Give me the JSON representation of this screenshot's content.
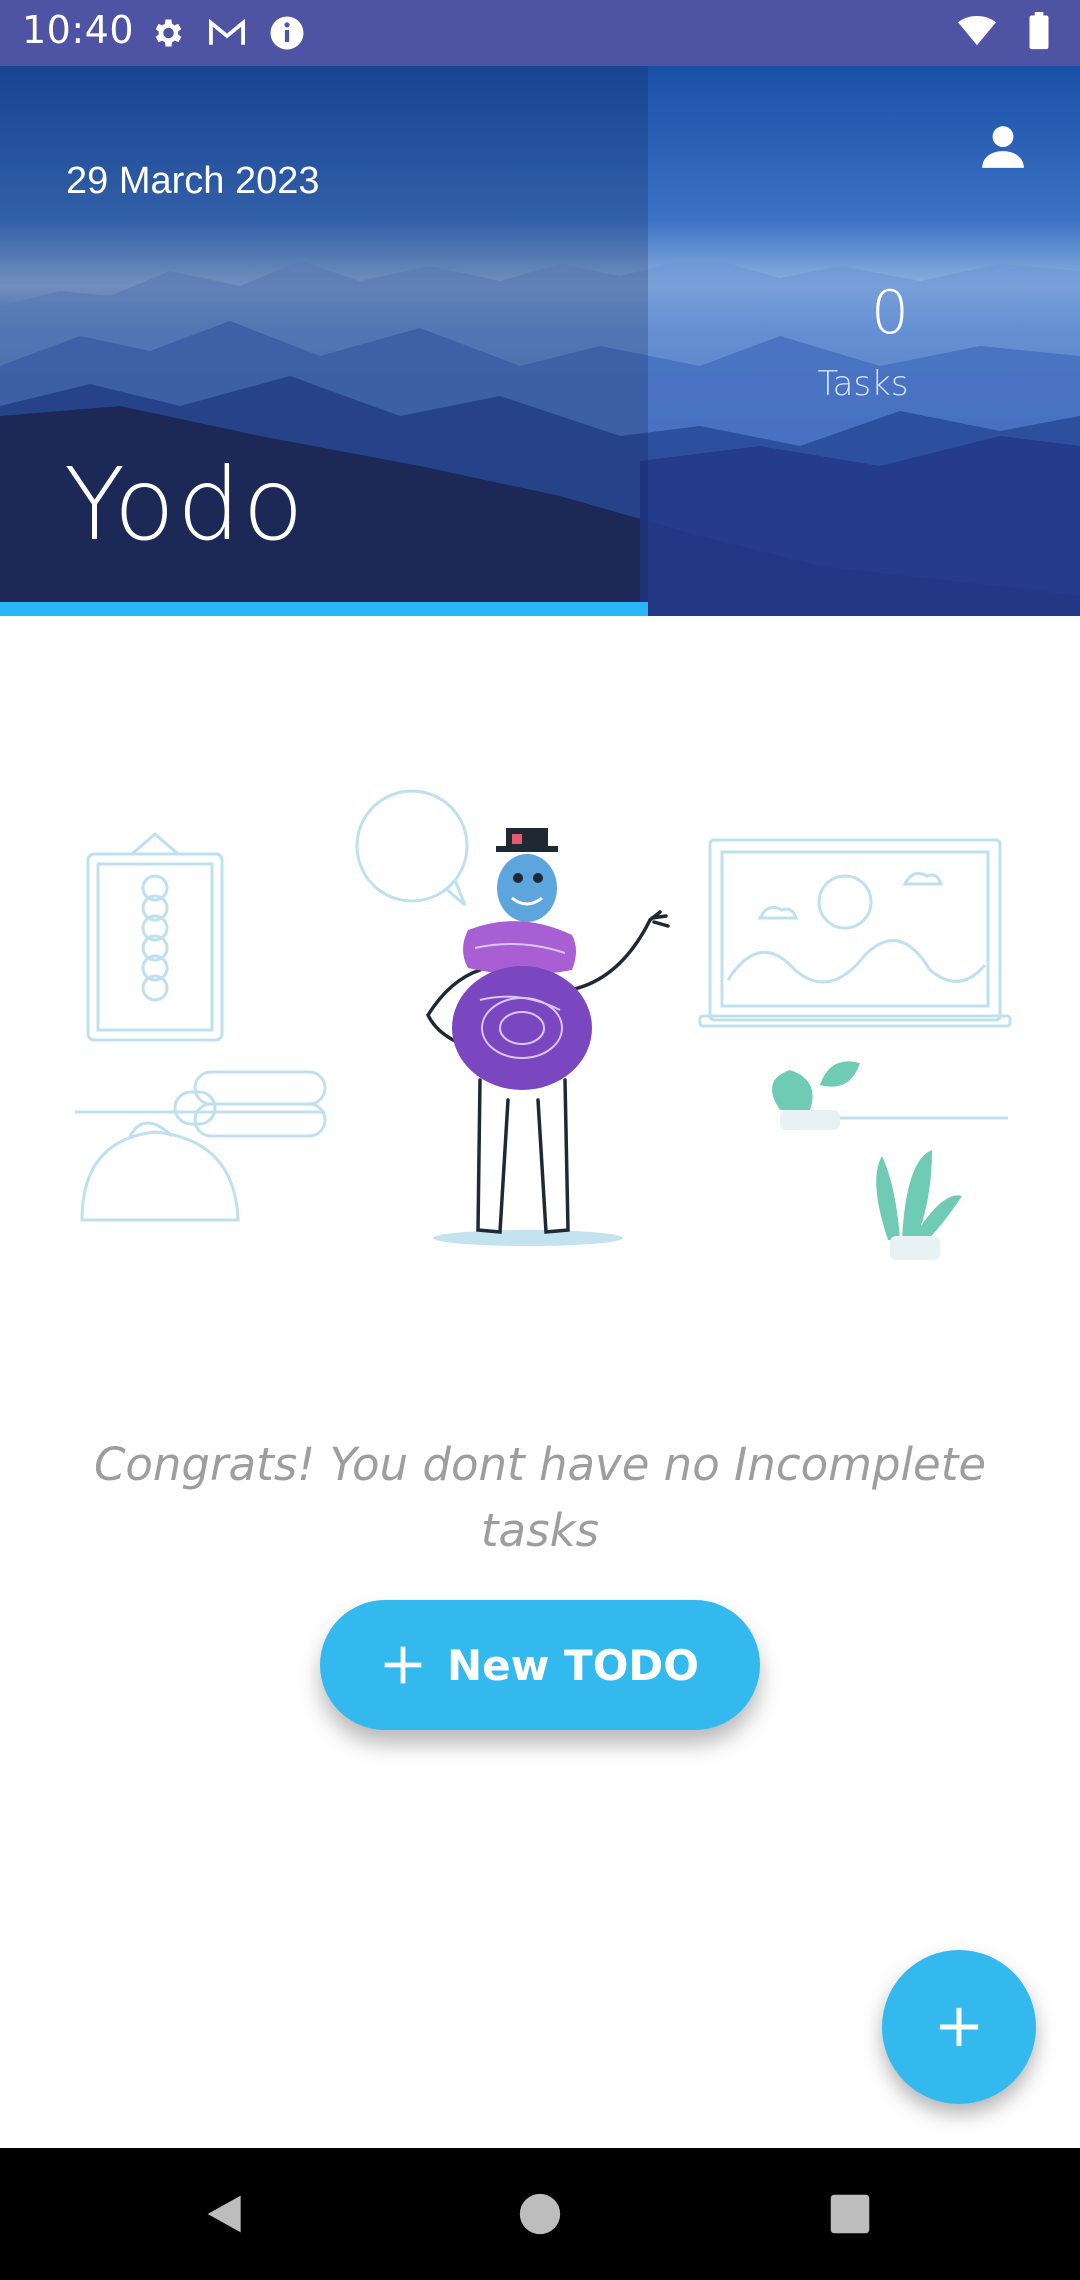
{
  "status_bar": {
    "time": "10:40",
    "left_icons": [
      "settings-icon",
      "gmail-icon",
      "info-icon"
    ],
    "right_icons": [
      "wifi-icon",
      "battery-icon"
    ]
  },
  "header": {
    "date": "29 March 2023",
    "title": "Yodo",
    "tasks_count": "0",
    "tasks_label": "Tasks",
    "profile_icon": "person-icon",
    "accent_color": "#29b6f6",
    "progress_fraction": 0.6
  },
  "empty_state": {
    "message": "Congrats! You dont have no Incomplete tasks"
  },
  "actions": {
    "new_todo_label": "New TODO",
    "new_todo_icon": "plus-icon",
    "fab_icon": "plus-icon",
    "button_color": "#33b9ee"
  },
  "navigation": {
    "buttons": [
      "back-icon",
      "home-icon",
      "recents-icon"
    ]
  }
}
